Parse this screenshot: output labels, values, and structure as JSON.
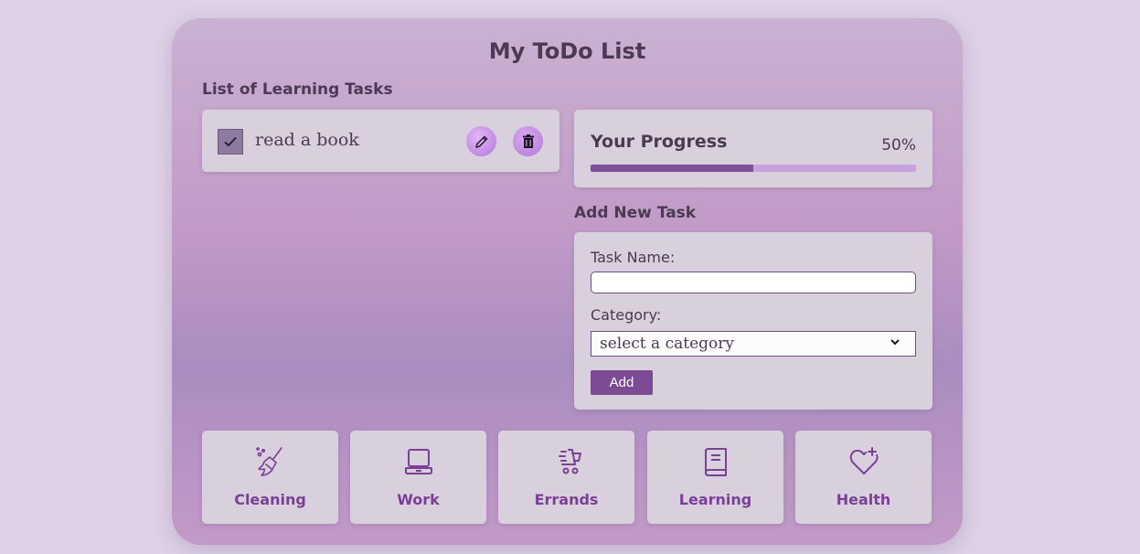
{
  "app": {
    "title": "My ToDo List"
  },
  "tasks_section": {
    "heading": "List of Learning Tasks",
    "tasks": [
      {
        "name": "read a book",
        "completed": true,
        "edit_icon": "pencil-icon",
        "delete_icon": "trash-icon"
      }
    ]
  },
  "progress": {
    "title": "Your Progress",
    "percent_label": "50%",
    "fraction": 0.5
  },
  "add_task": {
    "heading": "Add New Task",
    "task_name_label": "Task Name:",
    "task_name_value": "",
    "category_label": "Category:",
    "category_selected": "select a category",
    "add_label": "Add"
  },
  "categories": [
    {
      "label": "Cleaning",
      "icon": "broom-icon"
    },
    {
      "label": "Work",
      "icon": "laptop-icon"
    },
    {
      "label": "Errands",
      "icon": "shopping-cart-icon"
    },
    {
      "label": "Learning",
      "icon": "book-icon"
    },
    {
      "label": "Health",
      "icon": "heart-plus-icon"
    }
  ],
  "colors": {
    "accent": "#7d4b93",
    "category_text": "#7a3f96",
    "progress_fill": "#7d4f9b",
    "progress_track": "#c6a2de",
    "card_bg": "#d9d0dd"
  }
}
